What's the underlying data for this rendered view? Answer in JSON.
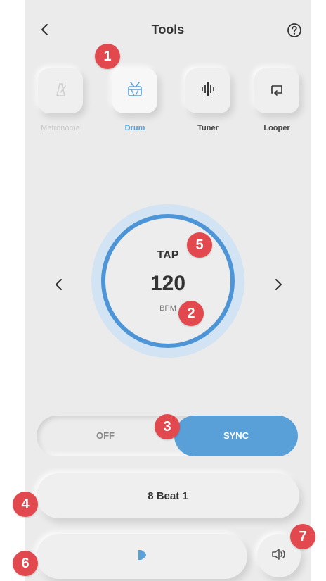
{
  "header": {
    "title": "Tools"
  },
  "tools": [
    {
      "label": "Metronome",
      "state": "dim"
    },
    {
      "label": "Drum",
      "state": "active"
    },
    {
      "label": "Tuner",
      "state": "normal"
    },
    {
      "label": "Looper",
      "state": "normal"
    }
  ],
  "dial": {
    "tap_label": "TAP",
    "bpm_value": "120",
    "bpm_unit": "BPM"
  },
  "sync_toggle": {
    "off_label": "OFF",
    "sync_label": "SYNC",
    "selected": "SYNC"
  },
  "pattern": {
    "label": "8 Beat 1"
  },
  "markers": [
    "1",
    "2",
    "3",
    "4",
    "5",
    "6",
    "7"
  ],
  "colors": {
    "accent": "#4d95d6",
    "marker": "#e2494e",
    "background": "#ebebeb"
  }
}
